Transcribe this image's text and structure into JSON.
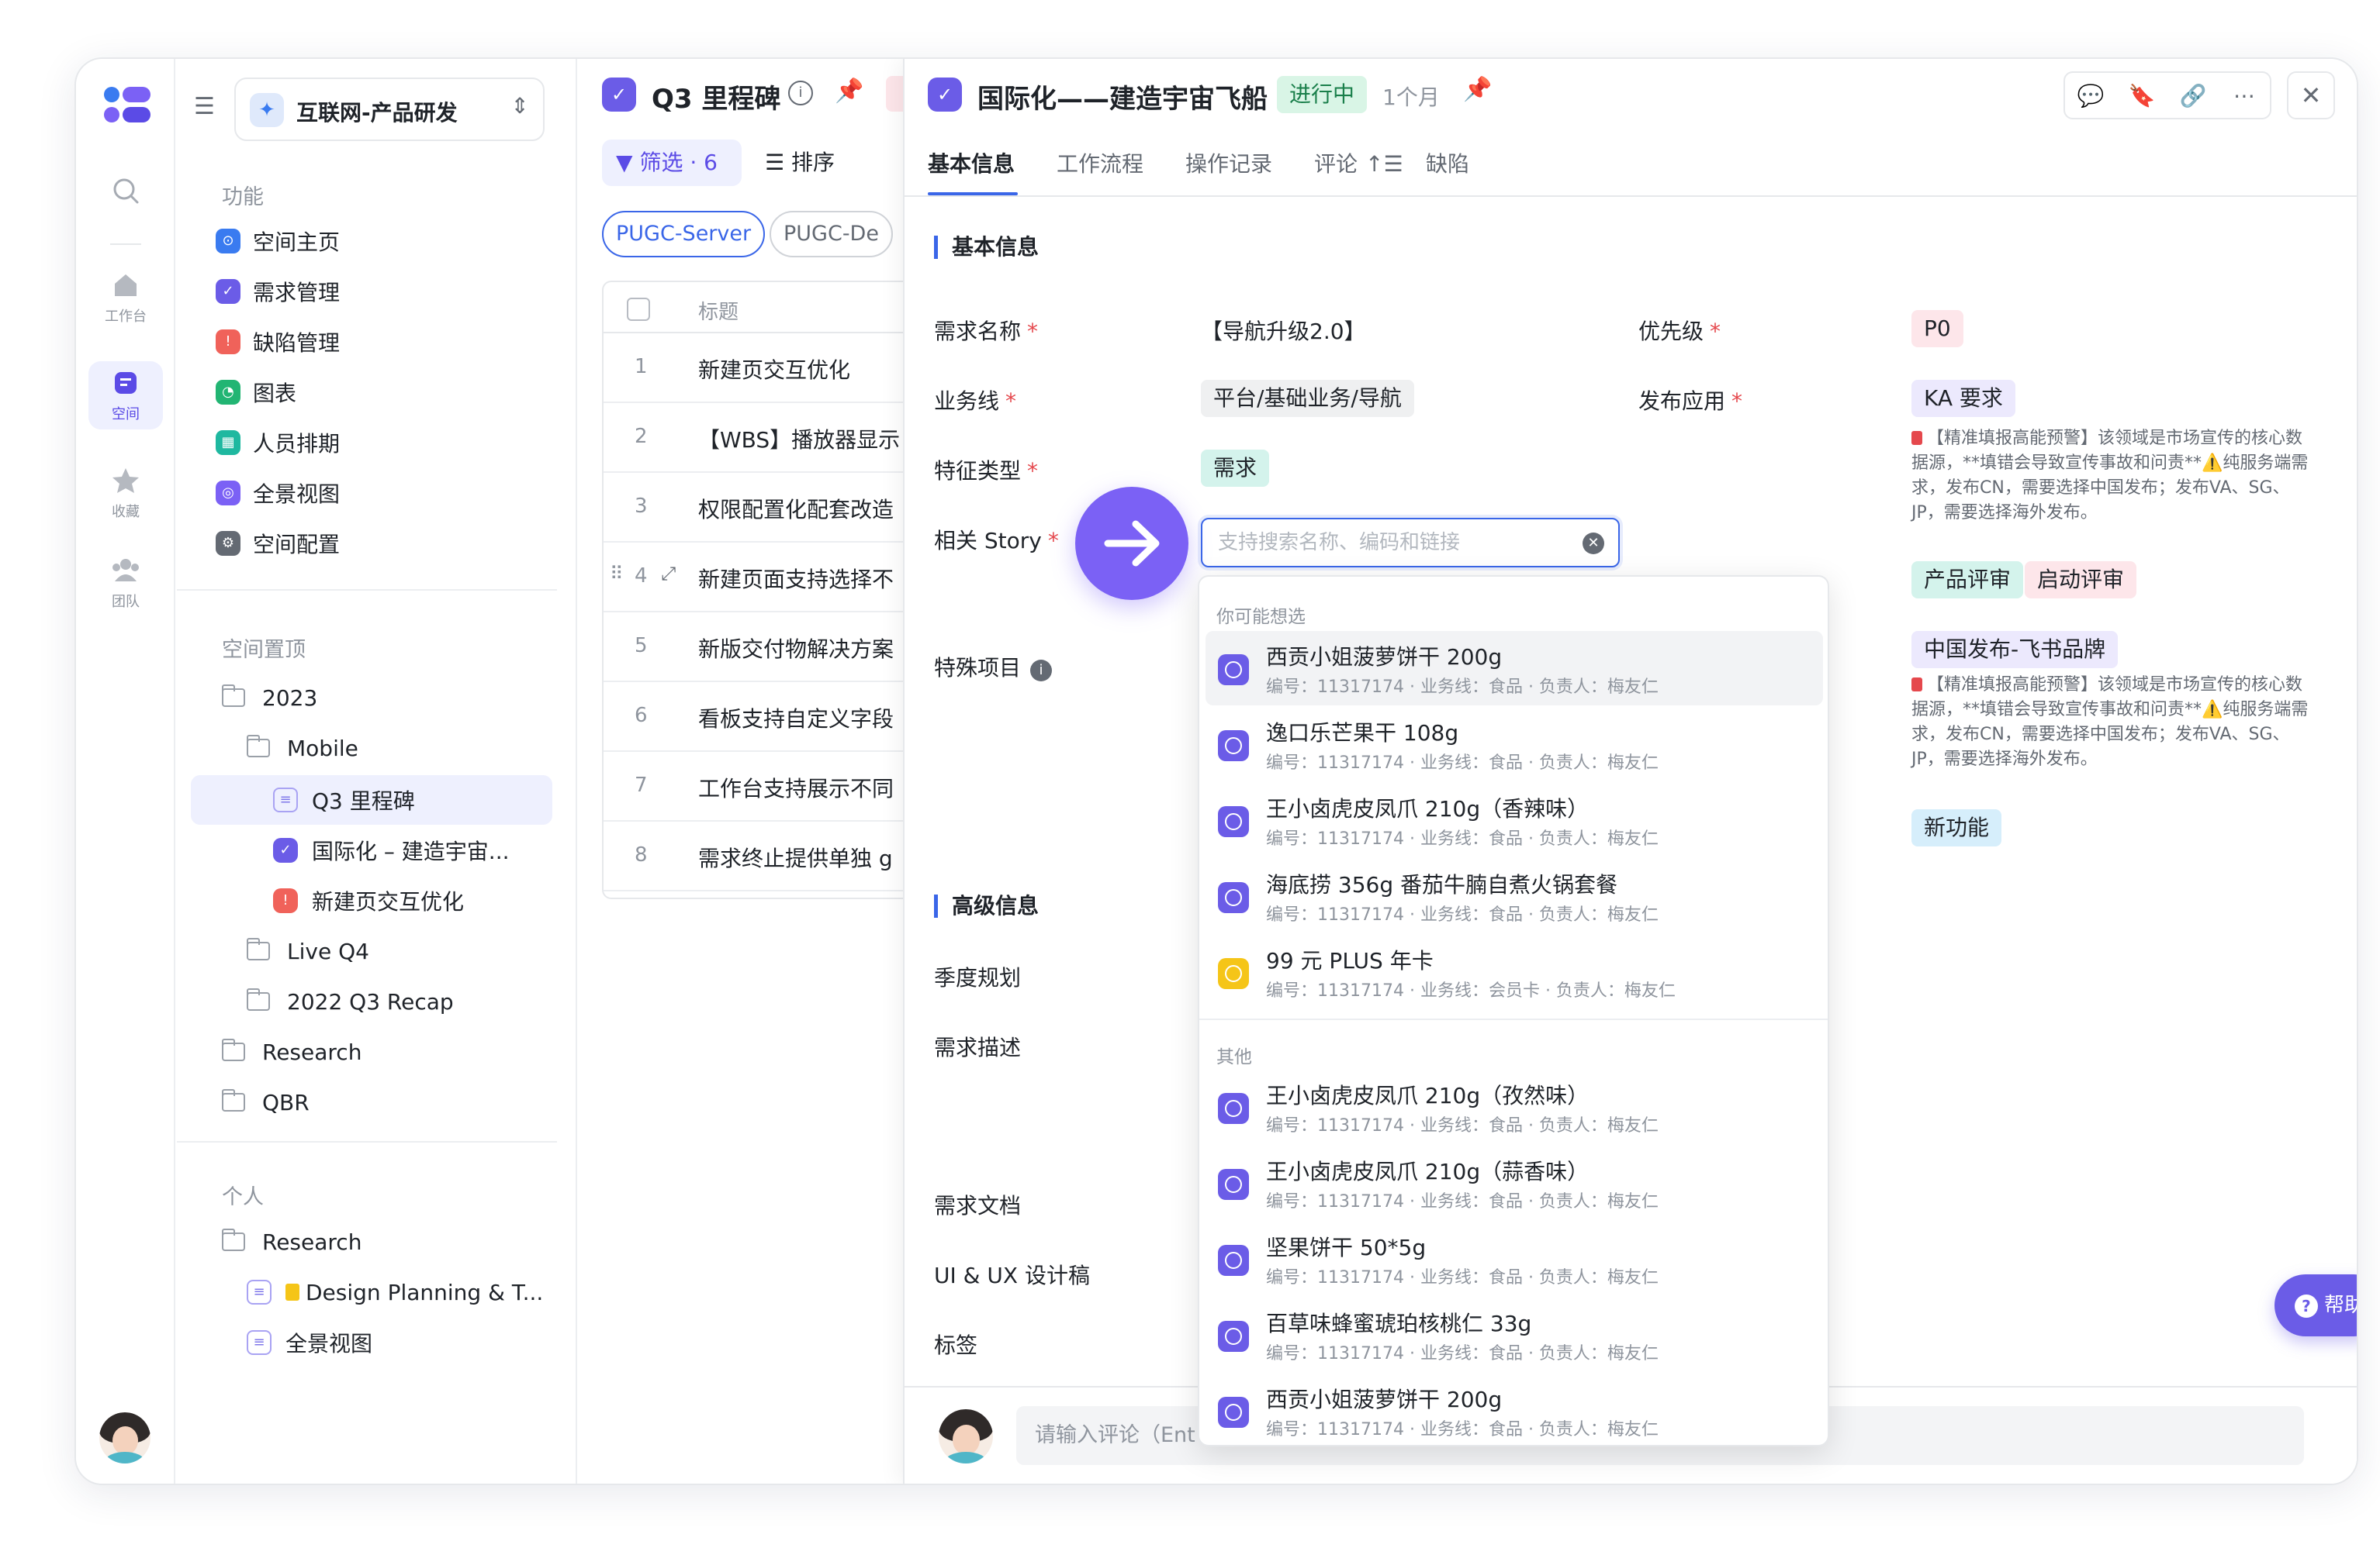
{
  "rail": {
    "items": [
      {
        "label": "工作台"
      },
      {
        "label": "空间"
      },
      {
        "label": "收藏"
      },
      {
        "label": "团队"
      }
    ]
  },
  "workspace": {
    "name": "互联网-产品研发"
  },
  "nav": {
    "section_features": "功能",
    "items": [
      {
        "label": "空间主页",
        "color": "#3a7bf0"
      },
      {
        "label": "需求管理",
        "color": "#6b5ce7"
      },
      {
        "label": "缺陷管理",
        "color": "#f0625a"
      },
      {
        "label": "图表",
        "color": "#22b573"
      },
      {
        "label": "人员排期",
        "color": "#1fb8a0"
      },
      {
        "label": "全景视图",
        "color": "#7b61f5"
      },
      {
        "label": "空间配置",
        "color": "#646a73"
      }
    ],
    "section_pinned": "空间置顶",
    "tree": [
      {
        "label": "2023"
      },
      {
        "label": "Mobile"
      },
      {
        "label": "Q3 里程碑"
      },
      {
        "label": "国际化 – 建造宇宙..."
      },
      {
        "label": "新建页交互优化"
      },
      {
        "label": "Live Q4"
      },
      {
        "label": "2022 Q3 Recap"
      },
      {
        "label": "Research"
      },
      {
        "label": "QBR"
      }
    ],
    "section_personal": "个人",
    "personal": [
      {
        "label": "Research"
      },
      {
        "label": "Design Planning & T..."
      },
      {
        "label": "全景视图"
      }
    ]
  },
  "list": {
    "title": "Q3 里程碑",
    "filter_label": "筛选 · 6",
    "sort_label": "排序",
    "chips": [
      "PUGC-Server",
      "PUGC-De"
    ],
    "header_title": "标题",
    "rows": [
      {
        "num": "1",
        "title": "新建页交互优化"
      },
      {
        "num": "2",
        "title": "【WBS】播放器显示"
      },
      {
        "num": "3",
        "title": "权限配置化配套改造"
      },
      {
        "num": "4",
        "title": "新建页面支持选择不"
      },
      {
        "num": "5",
        "title": "新版交付物解决方案"
      },
      {
        "num": "6",
        "title": "看板支持自定义字段"
      },
      {
        "num": "7",
        "title": "工作台支持展示不同"
      },
      {
        "num": "8",
        "title": "需求终止提供单独 g"
      }
    ]
  },
  "detail": {
    "title": "国际化——建造宇宙飞船",
    "status": "进行中",
    "time": "1个月",
    "tabs": [
      "基本信息",
      "工作流程",
      "操作记录",
      "评论",
      "缺陷"
    ],
    "section_basic": "基本信息",
    "fields": {
      "name_label": "需求名称",
      "name_value": "【导航升级2.0】",
      "priority_label": "优先级",
      "priority_value": "P0",
      "business_label": "业务线",
      "business_value": "平台/基础业务/导航",
      "release_label": "发布应用",
      "release_value": "KA 要求",
      "feature_label": "特征类型",
      "feature_value": "需求",
      "story_label": "相关 Story",
      "story_placeholder": "支持搜索名称、编码和链接",
      "special_label": "特殊项目"
    },
    "note_text": "【精准填报高能预警】该领域是市场宣传的核心数据源，**填错会导致宣传事故和问责**⚠️纯服务端需求，发布CN，需要选择中国发布；发布VA、SG、JP，需要选择海外发布。",
    "right_tags_1": [
      "产品评审",
      "启动评审"
    ],
    "right_tag_2": "中国发布-飞书品牌",
    "right_tag_3": "新功能",
    "section_advanced": "高级信息",
    "adv_fields": [
      "季度规划",
      "需求描述",
      "需求文档",
      "UI & UX 设计稿",
      "标签"
    ],
    "comment_placeholder": "请输入评论（Ent",
    "help_label": "帮助"
  },
  "dropdown": {
    "group_suggest": "你可能想选",
    "suggested": [
      {
        "name": "西贡小姐菠萝饼干 200g",
        "meta": "编号：11317174 · 业务线：食品 · 负责人：梅友仁",
        "icon": "purple"
      },
      {
        "name": "逸口乐芒果干 108g",
        "meta": "编号：11317174 · 业务线：食品 · 负责人：梅友仁",
        "icon": "purple"
      },
      {
        "name": "王小卤虎皮凤爪 210g（香辣味）",
        "meta": "编号：11317174 · 业务线：食品 · 负责人：梅友仁",
        "icon": "purple"
      },
      {
        "name": "海底捞 356g 番茄牛腩自煮火锅套餐",
        "meta": "编号：11317174 · 业务线：食品 · 负责人：梅友仁",
        "icon": "purple"
      },
      {
        "name": "99 元 PLUS 年卡",
        "meta": "编号：11317174 · 业务线：会员卡 · 负责人：梅友仁",
        "icon": "yellow"
      }
    ],
    "group_other": "其他",
    "others": [
      {
        "name": "王小卤虎皮凤爪 210g（孜然味）",
        "meta": "编号：11317174 · 业务线：食品 · 负责人：梅友仁"
      },
      {
        "name": "王小卤虎皮凤爪 210g（蒜香味）",
        "meta": "编号：11317174 · 业务线：食品 · 负责人：梅友仁"
      },
      {
        "name": "坚果饼干 50*5g",
        "meta": "编号：11317174 · 业务线：食品 · 负责人：梅友仁"
      },
      {
        "name": "百草味蜂蜜琥珀核桃仁 33g",
        "meta": "编号：11317174 · 业务线：食品 · 负责人：梅友仁"
      },
      {
        "name": "西贡小姐菠萝饼干 200g",
        "meta": "编号：11317174 · 业务线：食品 · 负责人：梅友仁"
      }
    ]
  },
  "colors": {
    "accent": "#3a66e8",
    "brand_purple": "#6b5ce7",
    "status_green_bg": "#d9f5e6"
  }
}
